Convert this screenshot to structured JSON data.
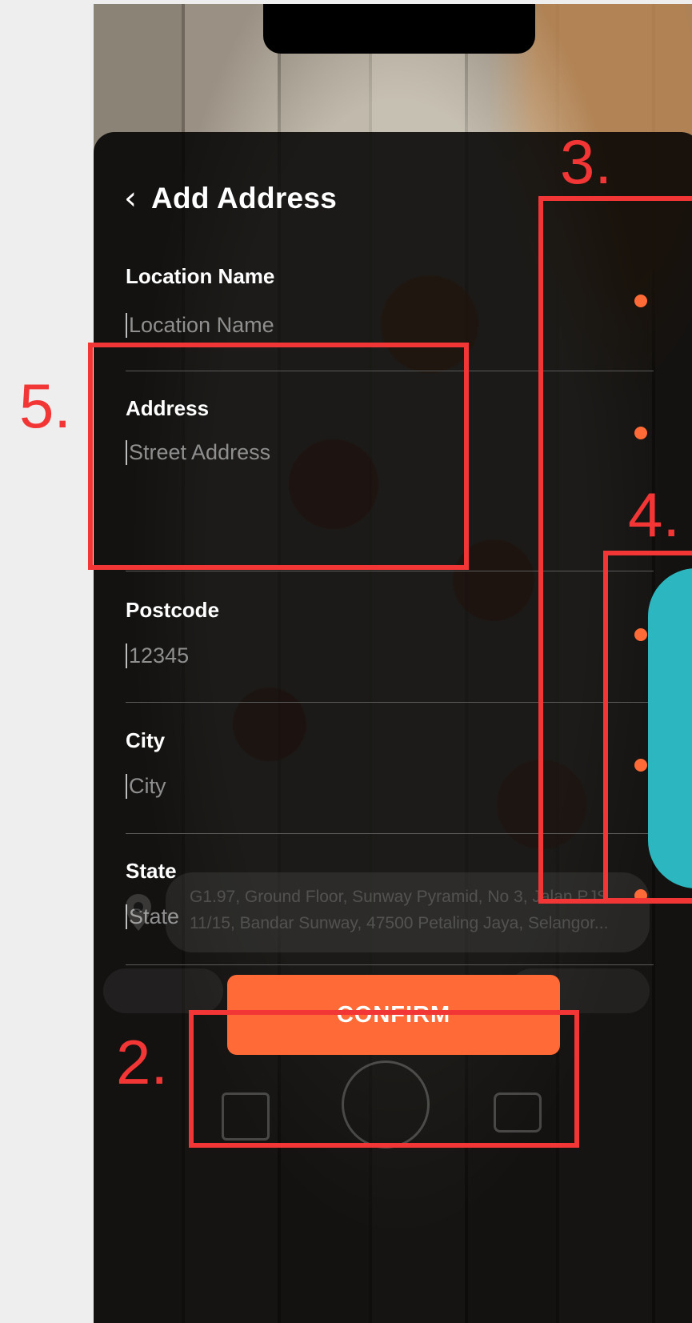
{
  "header": {
    "back_icon": "‹",
    "title": "Add Address"
  },
  "form": {
    "location_name": {
      "label": "Location Name",
      "placeholder": "Location Name"
    },
    "address": {
      "label": "Address",
      "placeholder": "Street Address"
    },
    "postcode": {
      "label": "Postcode",
      "placeholder": "12345"
    },
    "city": {
      "label": "City",
      "placeholder": "City"
    },
    "state": {
      "label": "State",
      "placeholder": "State"
    }
  },
  "background": {
    "location_text": "G1.97, Ground Floor, Sunway Pyramid, No 3, Jalan PJS\n11/15, Bandar Sunway, 47500 Petaling Jaya, Selangor..."
  },
  "confirm_label": "CONFIRM",
  "annotations": [
    {
      "label": "2."
    },
    {
      "label": "3."
    },
    {
      "label": "4."
    },
    {
      "label": "5."
    }
  ],
  "colors": {
    "accent": "#ff6a36",
    "annotation": "#f23535",
    "teal": "#2bb6c0"
  }
}
